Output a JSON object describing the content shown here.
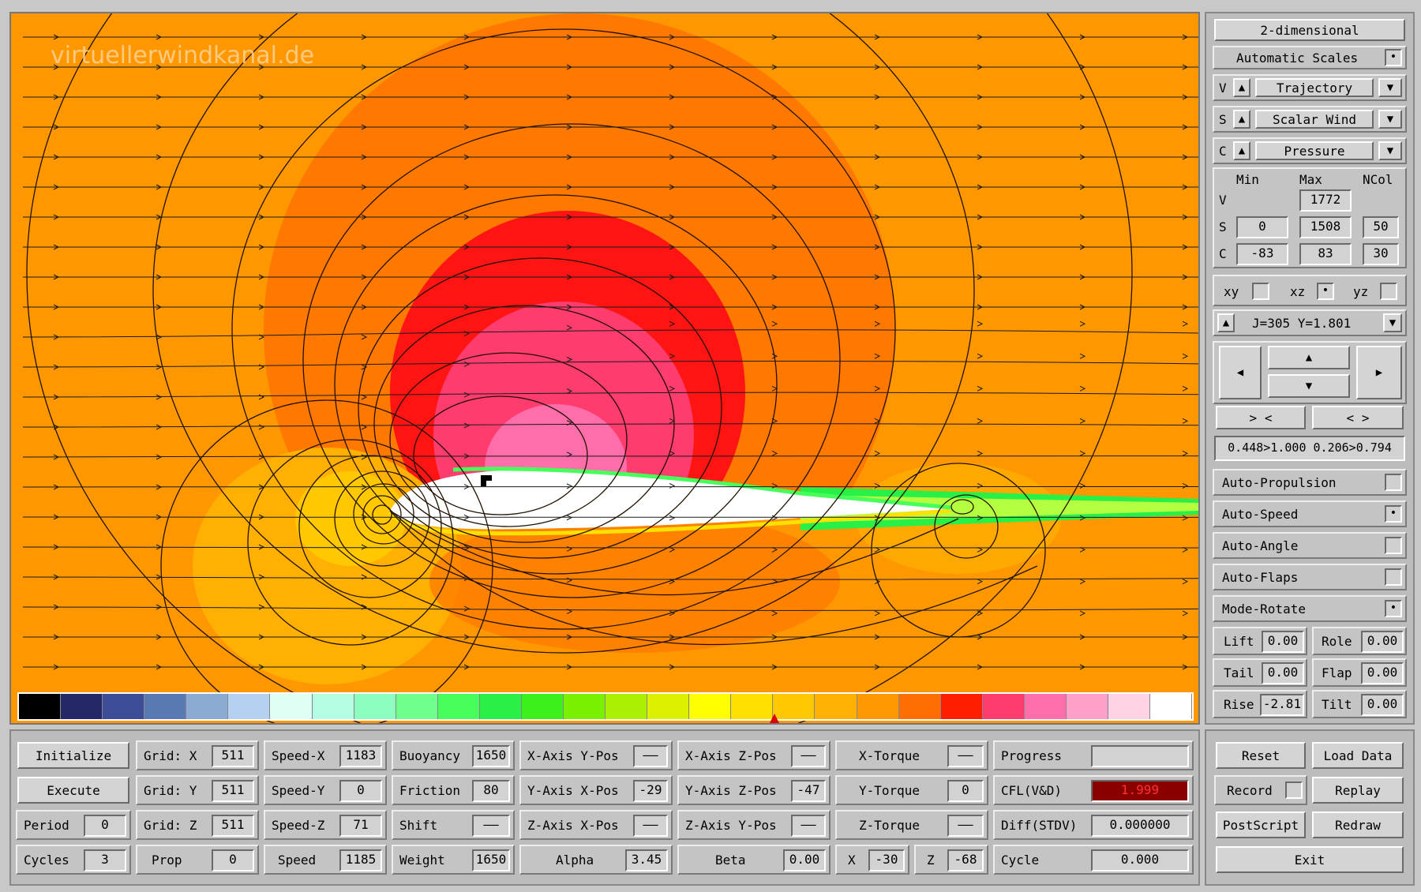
{
  "watermark": "virtuellerwindkanal.de",
  "colorbar": [
    "#000000",
    "#232864",
    "#3c4c96",
    "#5a78b4",
    "#8aaad2",
    "#b4d2f0",
    "#e0fff4",
    "#b4ffe4",
    "#8cffbe",
    "#6eff8c",
    "#46ff5a",
    "#28f046",
    "#3cf01e",
    "#78f000",
    "#aaf000",
    "#dcf000",
    "#ffff00",
    "#ffe000",
    "#ffc800",
    "#ffb000",
    "#ff9800",
    "#ff6e00",
    "#ff1e00",
    "#ff3c6e",
    "#ff6eaa",
    "#ffa0c8",
    "#ffd2e6",
    "#ffffff"
  ],
  "right": {
    "mode": "2-dimensional",
    "auto_scales": "Automatic Scales",
    "v_row": {
      "prefix": "V",
      "value": "Trajectory"
    },
    "s_row": {
      "prefix": "S",
      "value": "Scalar Wind"
    },
    "c_row": {
      "prefix": "C",
      "value": "Pressure"
    },
    "hdr": {
      "min": "Min",
      "max": "Max",
      "ncol": "NCol"
    },
    "v": {
      "label": "V",
      "max": "1772"
    },
    "s": {
      "label": "S",
      "min": "0",
      "max": "1508",
      "ncol": "50"
    },
    "c": {
      "label": "C",
      "min": "-83",
      "max": "83",
      "ncol": "30"
    },
    "planes": {
      "xy": "xy",
      "xz": "xz",
      "yz": "yz"
    },
    "slice": "J=305  Y=1.801",
    "zoom_in": "> <",
    "zoom_out": "< >",
    "range": "0.448>1.000 0.206>0.794",
    "auto_propulsion": "Auto-Propulsion",
    "auto_speed": "Auto-Speed",
    "auto_angle": "Auto-Angle",
    "auto_flaps": "Auto-Flaps",
    "mode_rotate": "Mode-Rotate",
    "lift": {
      "label": "Lift",
      "value": "0.00"
    },
    "role": {
      "label": "Role",
      "value": "0.00"
    },
    "tail": {
      "label": "Tail",
      "value": "0.00"
    },
    "flap": {
      "label": "Flap",
      "value": "0.00"
    },
    "rise": {
      "label": "Rise",
      "value": "-2.81"
    },
    "tilt": {
      "label": "Tilt",
      "value": "0.00"
    }
  },
  "bottom": {
    "initialize": "Initialize",
    "execute": "Execute",
    "period": {
      "label": "Period",
      "value": "0"
    },
    "cycles": {
      "label": "Cycles",
      "value": "3"
    },
    "grid_x": {
      "label": "Grid: X",
      "value": "511"
    },
    "grid_y": {
      "label": "Grid: Y",
      "value": "511"
    },
    "grid_z": {
      "label": "Grid: Z",
      "value": "511"
    },
    "prop": {
      "label": "Prop",
      "value": "0"
    },
    "speed_x": {
      "label": "Speed-X",
      "value": "1183"
    },
    "speed_y": {
      "label": "Speed-Y",
      "value": "0"
    },
    "speed_z": {
      "label": "Speed-Z",
      "value": "71"
    },
    "speed": {
      "label": "Speed",
      "value": "1185"
    },
    "buoyancy": {
      "label": "Buoyancy",
      "value": "1650"
    },
    "friction": {
      "label": "Friction",
      "value": "80"
    },
    "shift": {
      "label": "Shift",
      "value": "——"
    },
    "weight": {
      "label": "Weight",
      "value": "1650"
    },
    "xaxis_ypos": {
      "label": "X-Axis Y-Pos",
      "value": "——"
    },
    "yaxis_xpos": {
      "label": "Y-Axis X-Pos",
      "value": "-29"
    },
    "zaxis_xpos": {
      "label": "Z-Axis X-Pos",
      "value": "——"
    },
    "alpha": {
      "label": "Alpha",
      "value": "3.45"
    },
    "xaxis_zpos": {
      "label": "X-Axis Z-Pos",
      "value": "——"
    },
    "yaxis_zpos": {
      "label": "Y-Axis Z-Pos",
      "value": "-47"
    },
    "zaxis_ypos": {
      "label": "Z-Axis Y-Pos",
      "value": "——"
    },
    "beta": {
      "label": "Beta",
      "value": "0.00"
    },
    "x_torque": {
      "label": "X-Torque",
      "value": "——"
    },
    "y_torque": {
      "label": "Y-Torque",
      "value": "0"
    },
    "z_torque": {
      "label": "Z-Torque",
      "value": "——"
    },
    "x": {
      "label": "X",
      "value": "-30"
    },
    "z": {
      "label": "Z",
      "value": "-68"
    },
    "progress": {
      "label": "Progress",
      "value": 0
    },
    "cfl": {
      "label": "CFL(V&D)",
      "value": "1.999"
    },
    "diff": {
      "label": "Diff(STDV)",
      "value": "0.000000"
    },
    "cycle": {
      "label": "Cycle",
      "value": "0.000"
    },
    "reset": "Reset",
    "load_data": "Load Data",
    "record": "Record",
    "replay": "Replay",
    "postscript": "PostScript",
    "redraw": "Redraw",
    "exit": "Exit"
  }
}
